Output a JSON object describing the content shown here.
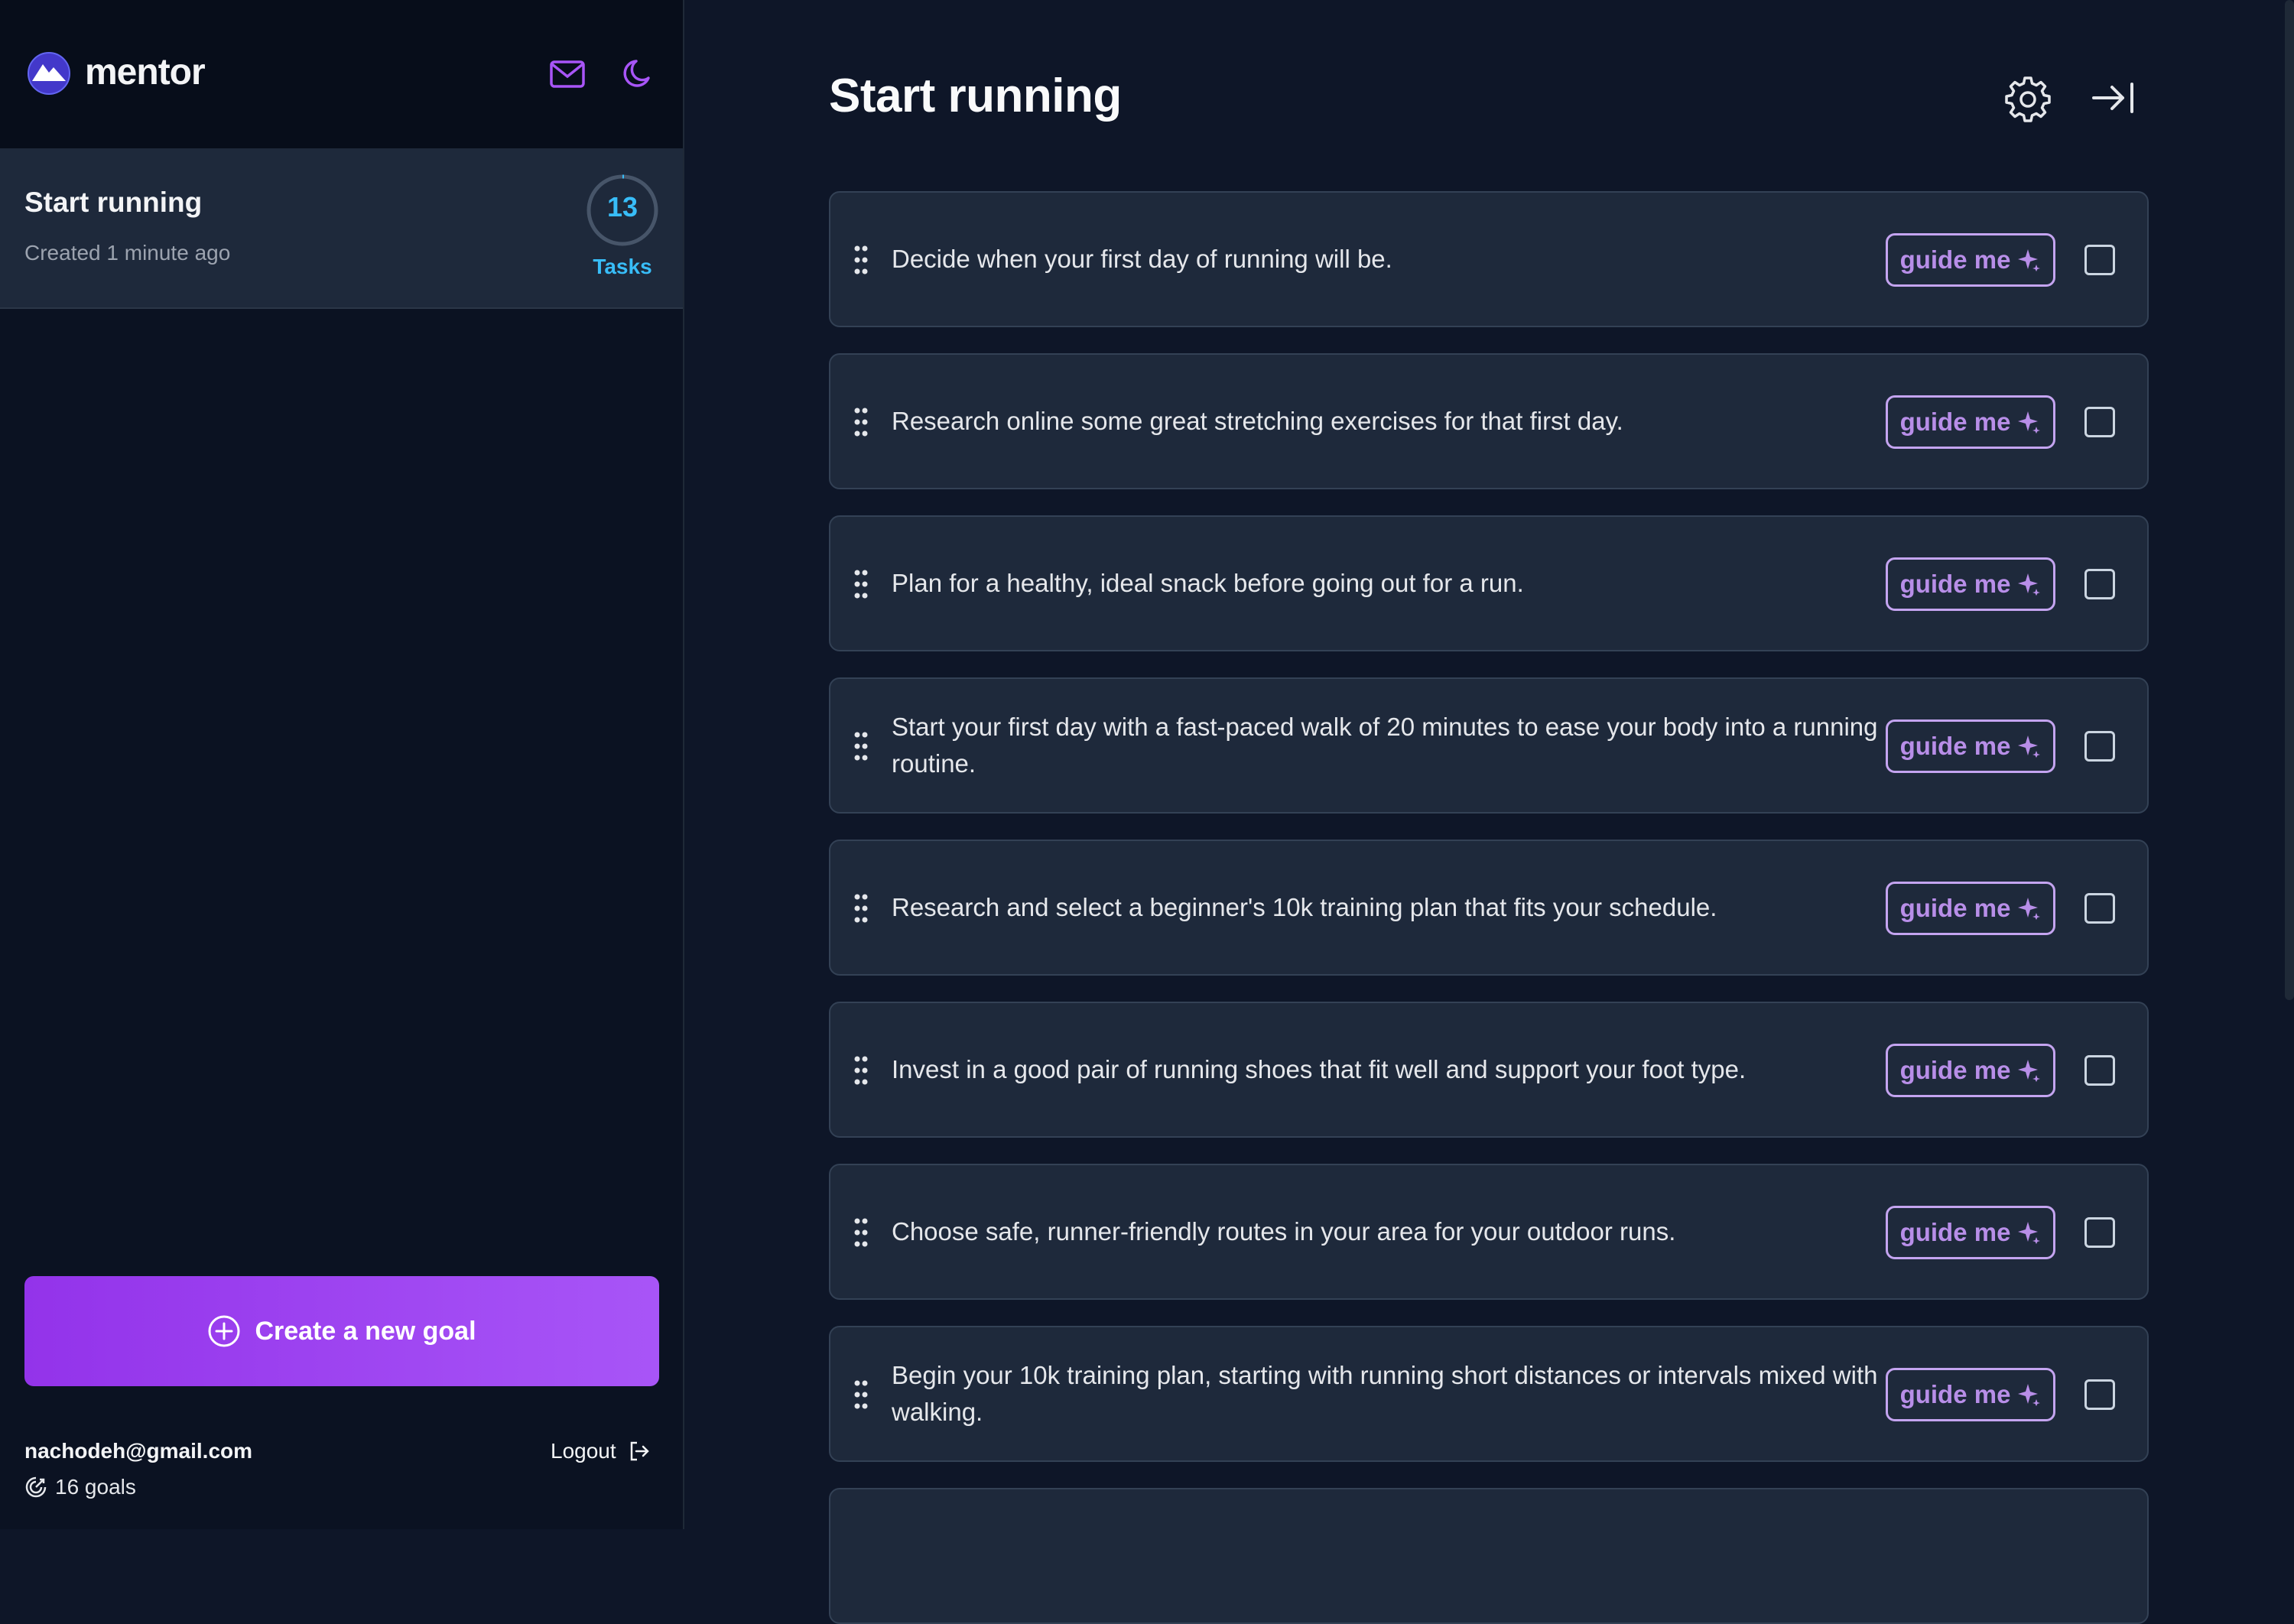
{
  "app": {
    "brand": "mentor"
  },
  "sidebar": {
    "goal": {
      "title": "Start running",
      "created": "Created 1 minute ago",
      "task_count": "13",
      "task_label": "Tasks"
    },
    "create_button": "Create a new goal",
    "user": {
      "email": "nachodeh@gmail.com",
      "goals": "16 goals"
    },
    "logout": "Logout"
  },
  "main": {
    "title": "Start running",
    "guide_label": "guide me",
    "tasks": [
      "Decide when your first day of running will be.",
      "Research online some great stretching exercises for that first day.",
      "Plan for a healthy, ideal snack before going out for a run.",
      "Start your first day with a fast-paced walk of 20 minutes to ease your body into a running routine.",
      "Research and select a beginner's 10k training plan that fits your schedule.",
      "Invest in a good pair of running shoes that fit well and support your foot type.",
      "Choose safe, runner-friendly routes in your area for your outdoor runs.",
      "Begin your 10k training plan, starting with running short distances or intervals mixed with walking."
    ]
  },
  "colors": {
    "accent": "#a855f7",
    "cyan": "#38bdf8",
    "background": "#0e1628",
    "card": "#1e293b"
  },
  "icons": [
    "mentor-logo-icon",
    "mail-icon",
    "moon-icon",
    "settings-gear-icon",
    "collapse-arrow-icon",
    "drag-handle-icon",
    "sparkle-icon",
    "plus-circle-icon",
    "logout-icon",
    "goals-icon"
  ]
}
